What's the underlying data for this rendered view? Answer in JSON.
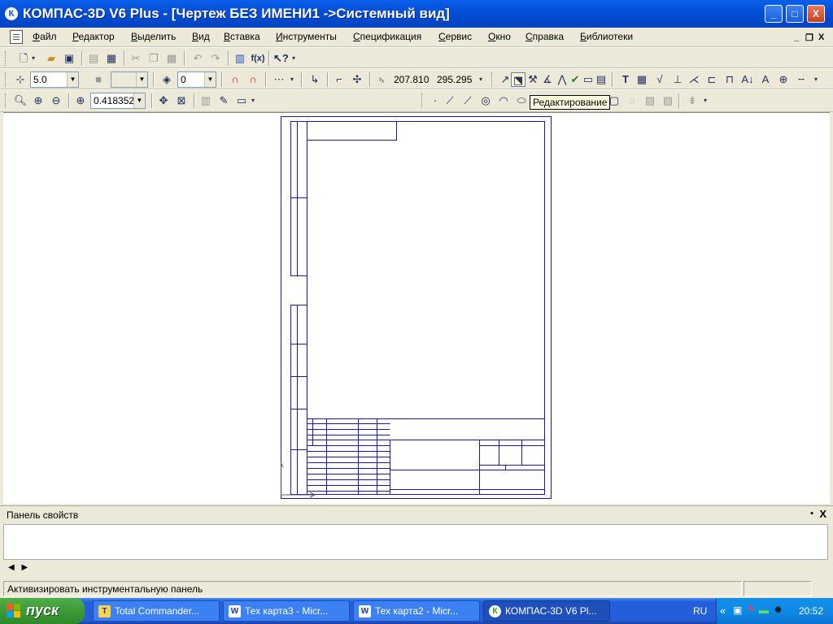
{
  "window": {
    "title": "КОМПАС-3D V6 Plus - [Чертеж БЕЗ ИМЕНИ1 ->Системный вид]",
    "app_icon": "К",
    "controls": {
      "minimize": "_",
      "maximize": "□",
      "close": "X"
    }
  },
  "menu": {
    "items": [
      "Файл",
      "Редактор",
      "Выделить",
      "Вид",
      "Вставка",
      "Инструменты",
      "Спецификация",
      "Сервис",
      "Окно",
      "Справка",
      "Библиотеки"
    ],
    "mdi_controls": {
      "minimize": "_",
      "restore": "❐",
      "close": "X"
    }
  },
  "toolbar_standard": {
    "icons": [
      "new-file-icon",
      "open-folder-icon",
      "save-disk-icon",
      "print-icon",
      "print-preview-icon",
      "cut-icon",
      "copy-icon",
      "paste-icon",
      "undo-icon",
      "redo-icon",
      "calculator-icon",
      "fx-icon",
      "help-pointer-icon"
    ],
    "fx_label": "f(x)"
  },
  "toolbar_current": {
    "step": "5.0",
    "layer_value": "0",
    "coord_x": "207.810",
    "coord_y": "295.295"
  },
  "toolbar_view": {
    "zoom": "0.418352"
  },
  "tooltip": {
    "text": "Редактирование"
  },
  "properties_panel": {
    "title": "Панель свойств",
    "pin": "▪",
    "close": "X",
    "nav_left": "◀",
    "nav_right": "▶"
  },
  "status_bar": {
    "message": "Активизировать инструментальную панель"
  },
  "taskbar": {
    "start_label": "пуск",
    "tasks": [
      {
        "label": "Total Commander...",
        "icon": "T"
      },
      {
        "label": "Тех карта3 - Micr...",
        "icon": "W"
      },
      {
        "label": "Тех карта2 - Micr...",
        "icon": "W"
      },
      {
        "label": "КОМПАС-3D V6 Pl...",
        "icon": "К"
      }
    ],
    "language": "RU",
    "clock": "20:52"
  },
  "colors": {
    "drawing_line": "#1a1aa0",
    "title_bar": "#0a5fe8",
    "taskbar": "#245edb",
    "start_button": "#3c9a37"
  }
}
